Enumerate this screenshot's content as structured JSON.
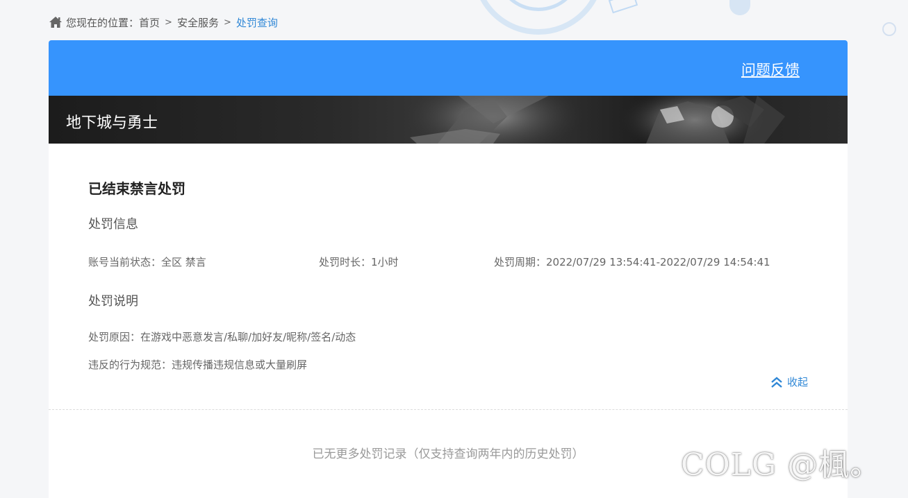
{
  "breadcrumb": {
    "prefix": "您现在的位置：",
    "items": [
      "首页",
      "安全服务",
      "处罚查询"
    ],
    "separator": ">"
  },
  "header": {
    "feedback_label": "问题反馈",
    "color": "#3694fd"
  },
  "banner": {
    "game_title": "地下城与勇士"
  },
  "punishment": {
    "title": "已结束禁言处罚",
    "info_heading": "处罚信息",
    "status": "账号当前状态：全区 禁言",
    "duration": "处罚时长：1小时",
    "period": "处罚周期：2022/07/29 13:54:41-2022/07/29 14:54:41",
    "explain_heading": "处罚说明",
    "reason": "处罚原因：在游戏中恶意发言/私聊/加好友/昵称/签名/动态",
    "violation": "违反的行为规范：违规传播违规信息或大量刷屏",
    "collapse_label": "收起"
  },
  "footer": {
    "no_more": "已无更多处罚记录（仅支持查询两年内的历史处罚）"
  },
  "watermark": {
    "text": "COLG @楓。"
  },
  "icons": {
    "breadcrumb": "home-icon",
    "collapse": "double-chevron-up-icon"
  },
  "colors": {
    "accent": "#2f87d6",
    "header": "#3694fd"
  }
}
